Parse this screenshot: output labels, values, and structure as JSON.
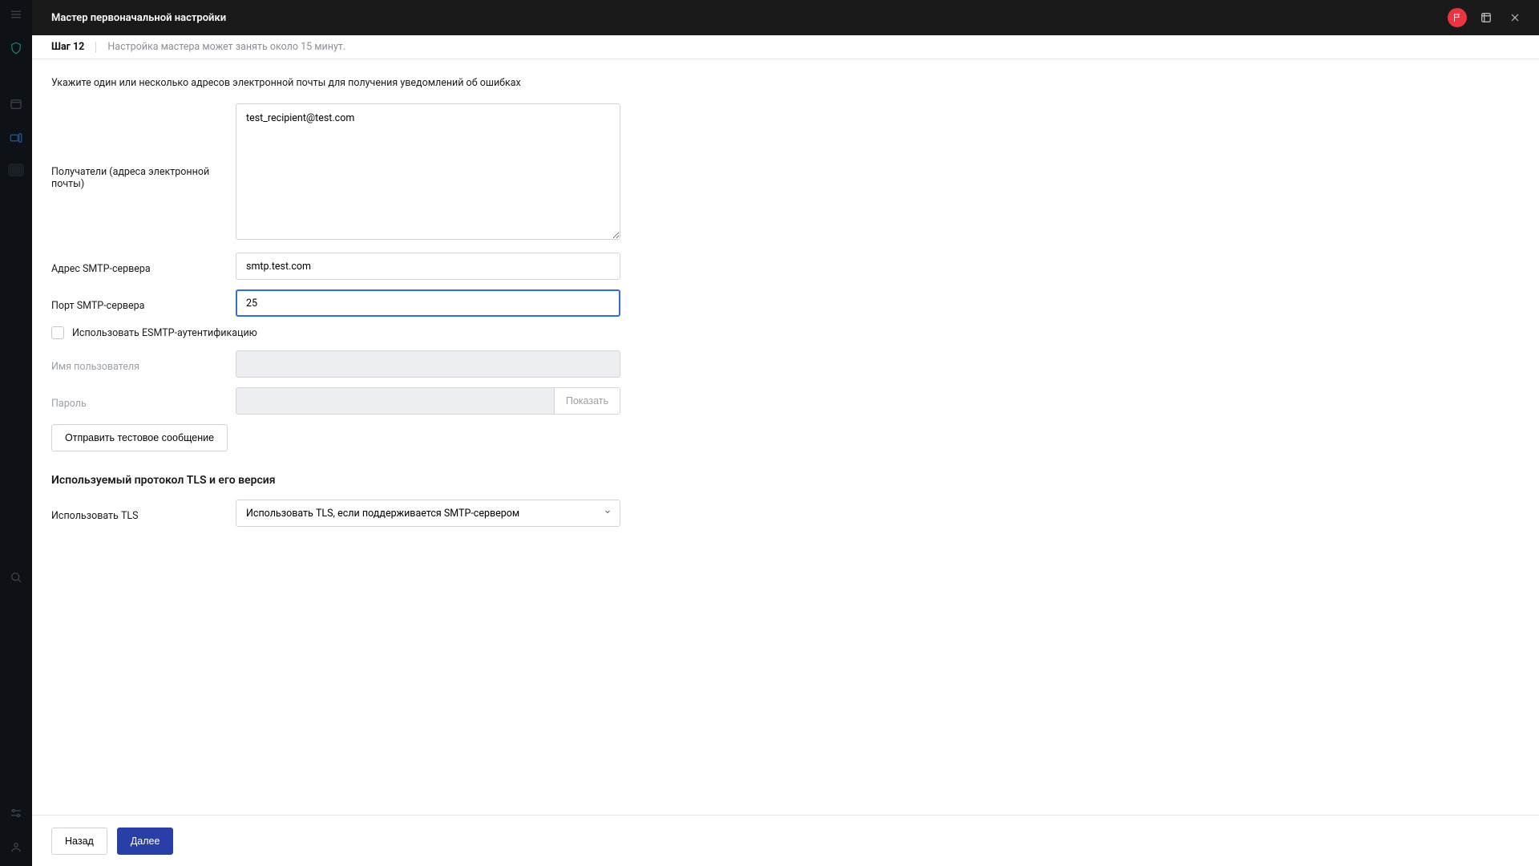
{
  "header": {
    "title": "Мастер первоначальной настройки"
  },
  "stepbar": {
    "step": "Шаг 12",
    "hint": "Настройка мастера может занять около 15 минут."
  },
  "intro": "Укажите один или несколько адресов электронной почты для получения уведомлений об ошибках",
  "form": {
    "recipients_label": "Получатели (адреса электронной почты)",
    "recipients_value": "test_recipient@test.com",
    "smtp_addr_label": "Адрес SMTP-сервера",
    "smtp_addr_value": "smtp.test.com",
    "smtp_port_label": "Порт SMTP-сервера",
    "smtp_port_value": "25",
    "esmtp_label": "Использовать ESMTP-аутентификацию",
    "esmtp_checked": false,
    "username_label": "Имя пользователя",
    "username_value": "",
    "password_label": "Пароль",
    "password_value": "",
    "show_password_label": "Показать",
    "send_test_label": "Отправить тестовое сообщение",
    "tls_section_title": "Используемый протокол TLS и его версия",
    "tls_label": "Использовать TLS",
    "tls_value": "Использовать TLS, если поддерживается SMTP-сервером"
  },
  "footer": {
    "back": "Назад",
    "next": "Далее"
  }
}
